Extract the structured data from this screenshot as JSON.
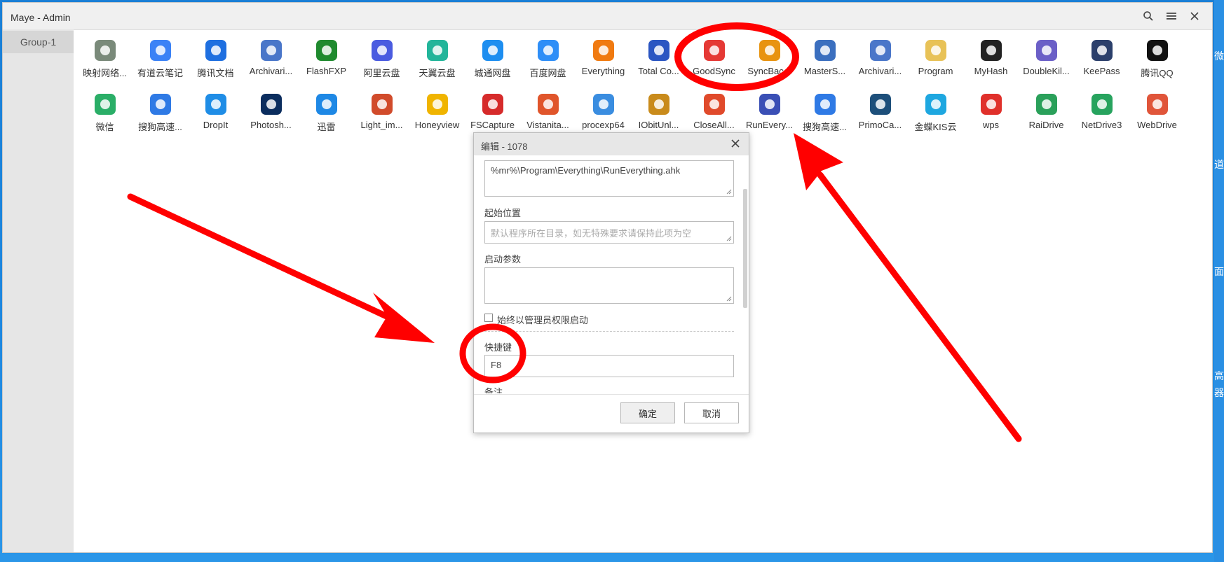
{
  "window": {
    "title": "Maye - Admin"
  },
  "sidebar": {
    "groups": [
      {
        "label": "Group-1"
      }
    ]
  },
  "apps_row1": [
    {
      "label": "映射网络...",
      "icon": "network-drive-icon",
      "color": "#7a8a7a"
    },
    {
      "label": "有道云笔记",
      "icon": "youdao-note-icon",
      "color": "#3b82f6"
    },
    {
      "label": "腾讯文档",
      "icon": "tencent-docs-icon",
      "color": "#1e6fe0"
    },
    {
      "label": "Archivari...",
      "icon": "archivarius-icon",
      "color": "#4a76c9"
    },
    {
      "label": "FlashFXP",
      "icon": "flashfxp-icon",
      "color": "#1f8a2e"
    },
    {
      "label": "阿里云盘",
      "icon": "aliyun-drive-icon",
      "color": "#4a5be0"
    },
    {
      "label": "天翼云盘",
      "icon": "tianyi-cloud-icon",
      "color": "#22b59a"
    },
    {
      "label": "城通网盘",
      "icon": "ctfile-icon",
      "color": "#1d8ef0"
    },
    {
      "label": "百度网盘",
      "icon": "baidu-netdisk-icon",
      "color": "#2e8ef7"
    },
    {
      "label": "Everything",
      "icon": "everything-search-icon",
      "color": "#f07a10"
    },
    {
      "label": "Total Co...",
      "icon": "total-commander-icon",
      "color": "#2a55c2"
    },
    {
      "label": "GoodSync",
      "icon": "goodsync-icon",
      "color": "#e53935"
    },
    {
      "label": "SyncBac...",
      "icon": "syncbackpro-icon",
      "color": "#e89310"
    },
    {
      "label": "MasterS...",
      "icon": "mastersync-icon",
      "color": "#3b6fbf"
    },
    {
      "label": "Archivari...",
      "icon": "archivarius-icon",
      "color": "#4a76c9"
    },
    {
      "label": "Program",
      "icon": "folder-icon",
      "color": "#e8c257"
    },
    {
      "label": "MyHash",
      "icon": "myhash-icon",
      "color": "#222222"
    },
    {
      "label": "DoubleKil...",
      "icon": "doublekiller-icon",
      "color": "#6b5fc7"
    },
    {
      "label": "KeePass",
      "icon": "keepass-lock-icon",
      "color": "#2b3f6b"
    },
    {
      "label": "腾讯QQ",
      "icon": "qq-penguin-icon",
      "color": "#111111"
    }
  ],
  "apps_row2": [
    {
      "label": "微信",
      "icon": "wechat-icon",
      "color": "#2aae67"
    },
    {
      "label": "搜狗高速...",
      "icon": "sogou-browser-icon",
      "color": "#2f7ae5"
    },
    {
      "label": "DropIt",
      "icon": "dropit-icon",
      "color": "#1f8de6"
    },
    {
      "label": "Photosh...",
      "icon": "photoshop-icon",
      "color": "#0b2d5e"
    },
    {
      "label": "迅雷",
      "icon": "xunlei-icon",
      "color": "#1e88e5"
    },
    {
      "label": "Light_im...",
      "icon": "light-image-icon",
      "color": "#d14b2b"
    },
    {
      "label": "Honeyview",
      "icon": "honeyview-icon",
      "color": "#f0b400"
    },
    {
      "label": "FSCapture",
      "icon": "fscapture-icon",
      "color": "#d62b2b"
    },
    {
      "label": "Vistanita...",
      "icon": "vistanita-icon",
      "color": "#e0552b"
    },
    {
      "label": "procexp64",
      "icon": "process-explorer-icon",
      "color": "#3a8de0"
    },
    {
      "label": "IObitUnl...",
      "icon": "iobit-unlocker-icon",
      "color": "#c98b1b"
    },
    {
      "label": "CloseAll...",
      "icon": "closeall-icon",
      "color": "#e04a2b"
    },
    {
      "label": "RunEvery...",
      "icon": "runeverything-icon",
      "color": "#3a4fb5"
    },
    {
      "label": "搜狗高速...",
      "icon": "sogou-browser-icon",
      "color": "#2f7ae5"
    },
    {
      "label": "PrimoCa...",
      "icon": "primocache-icon",
      "color": "#1d4f7a"
    },
    {
      "label": "金蝶KIS云",
      "icon": "kingdee-cloud-icon",
      "color": "#1ea7e0"
    },
    {
      "label": "wps",
      "icon": "wps-icon",
      "color": "#e0302b"
    },
    {
      "label": "RaiDrive",
      "icon": "raidrive-icon",
      "color": "#2aa05a"
    },
    {
      "label": "NetDrive3",
      "icon": "netdrive-icon",
      "color": "#27a35e"
    },
    {
      "label": "WebDrive",
      "icon": "webdrive-icon",
      "color": "#e0553a"
    }
  ],
  "dialog": {
    "title": "编辑 - 1078",
    "path_value": "%mr%\\Program\\Everything\\RunEverything.ahk",
    "start_dir_label": "起始位置",
    "start_dir_placeholder": "默认程序所在目录，如无特殊要求请保持此项为空",
    "args_label": "启动参数",
    "args_value": "",
    "admin_checkbox_label": "始终以管理员权限启动",
    "admin_checked": false,
    "hotkey_label": "快捷键",
    "hotkey_value": "F8",
    "note_label": "备注",
    "ok_label": "确定",
    "cancel_label": "取消"
  },
  "annotation_color": "#ff0000",
  "desktop_glyphs": [
    "微",
    "道",
    "面",
    "高",
    "器"
  ]
}
